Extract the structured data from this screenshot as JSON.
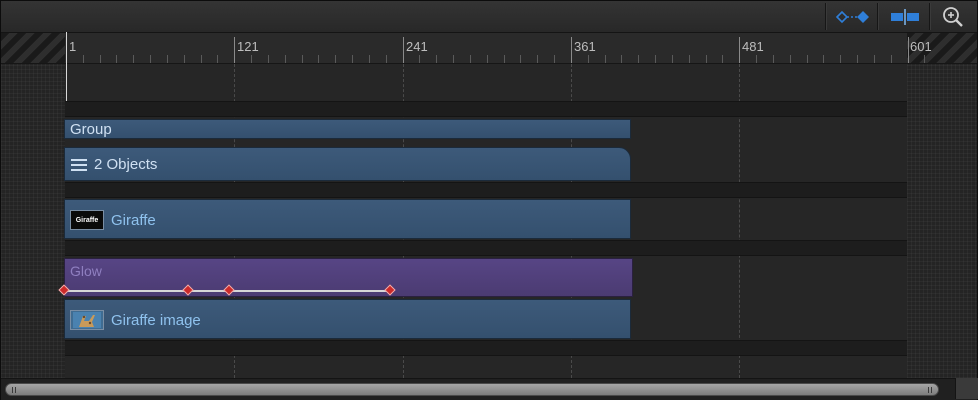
{
  "toolbar": {
    "buttons": [
      {
        "name": "show-keyframes-button",
        "icon": "keyframe-diamonds-icon",
        "color": "#2f7fd9"
      },
      {
        "name": "snapping-button",
        "icon": "snapping-icon",
        "color": "#2f7fd9"
      },
      {
        "name": "zoom-button",
        "icon": "magnifier-icon",
        "color": "#cfcfcf"
      }
    ]
  },
  "ruler": {
    "labels": [
      "1",
      "121",
      "241",
      "361",
      "481",
      "601"
    ]
  },
  "tracks": {
    "group": {
      "label": "Group",
      "sublabel": "2 Objects",
      "icon": "list-icon",
      "color": "#3a5878"
    },
    "giraffe": {
      "label": "Giraffe",
      "thumb_text": "Giraffe",
      "color": "#3a5878"
    },
    "glow": {
      "label": "Glow",
      "color": "#52427a",
      "keyframe_frames": [
        1,
        90,
        120,
        235
      ]
    },
    "giraffe_image": {
      "label": "Giraffe image",
      "thumb_icon": "giraffe-thumbnail-icon",
      "color": "#3a5878"
    }
  },
  "scrollbar": {
    "position": 0.0
  }
}
